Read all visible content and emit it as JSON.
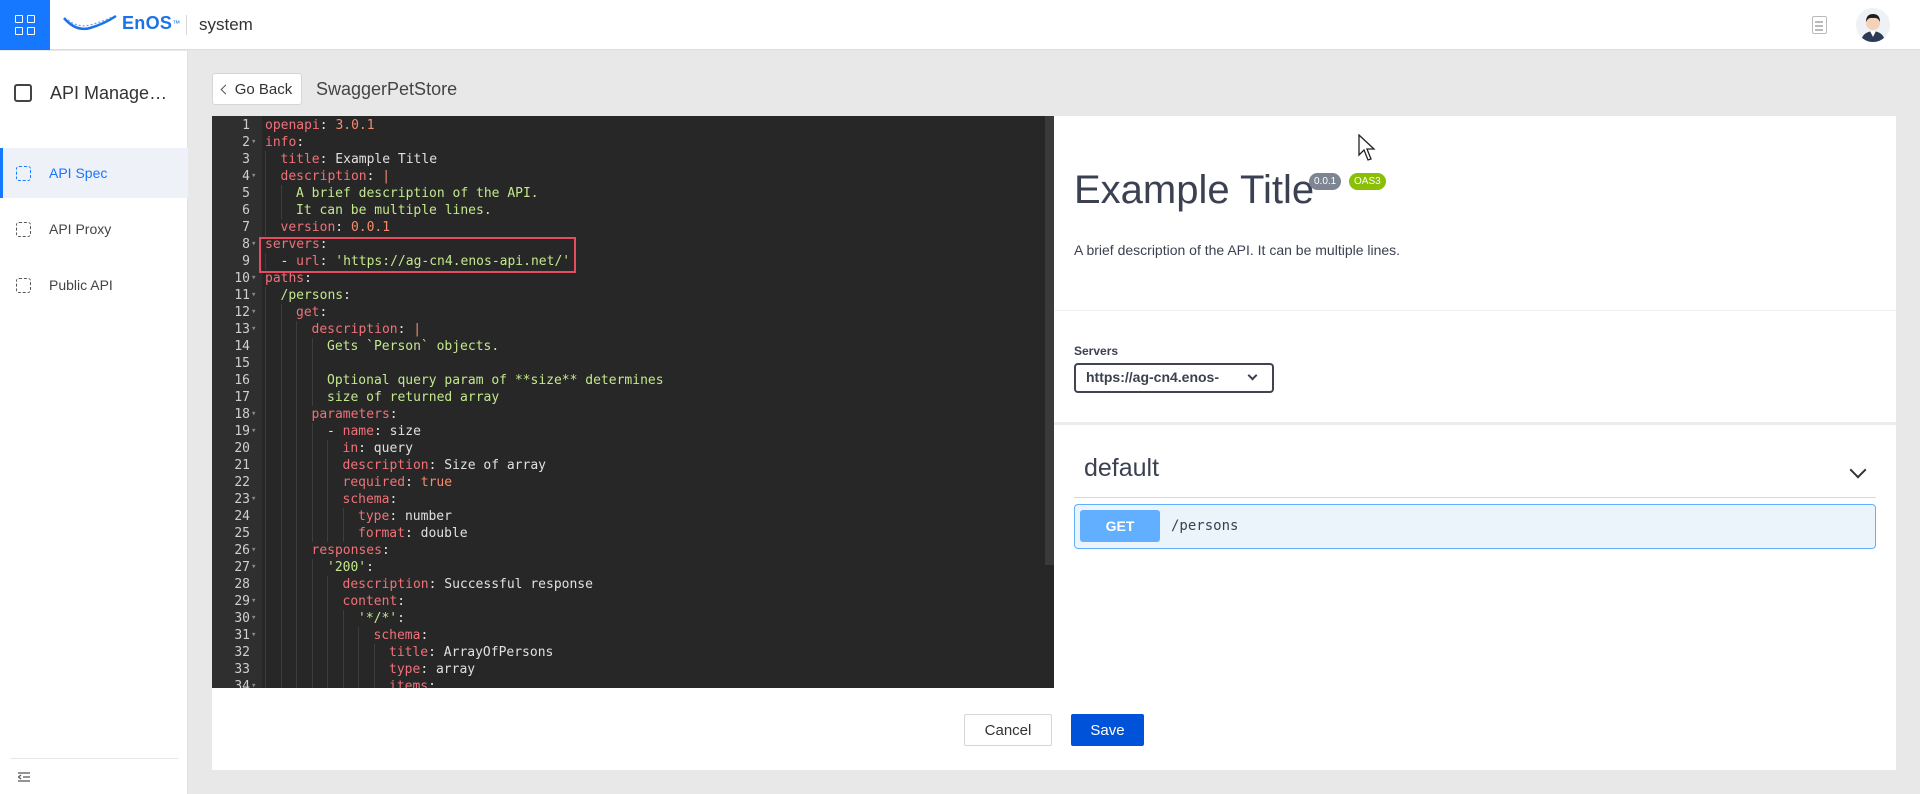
{
  "topbar": {
    "brand": "EnOS",
    "brand_tm": "™",
    "app_name": "system"
  },
  "sidebar": {
    "header": "API Management",
    "items": [
      {
        "label": "API Spec",
        "active": true
      },
      {
        "label": "API Proxy",
        "active": false
      },
      {
        "label": "Public API",
        "active": false
      }
    ]
  },
  "page": {
    "back_label": "Go Back",
    "title": "SwaggerPetStore"
  },
  "editor": {
    "lines": [
      {
        "n": "1",
        "fold": "",
        "indent": 0,
        "t": [
          [
            "k",
            "openapi"
          ],
          [
            "v",
            ": "
          ],
          [
            "n",
            "3.0.1"
          ]
        ]
      },
      {
        "n": "2",
        "fold": "▾",
        "indent": 0,
        "t": [
          [
            "k",
            "info"
          ],
          [
            "v",
            ":"
          ]
        ]
      },
      {
        "n": "3",
        "fold": "",
        "indent": 1,
        "t": [
          [
            "k",
            "title"
          ],
          [
            "v",
            ": Example Title"
          ]
        ]
      },
      {
        "n": "4",
        "fold": "▾",
        "indent": 1,
        "t": [
          [
            "k",
            "description"
          ],
          [
            "v",
            ": "
          ],
          [
            "n",
            "|"
          ]
        ]
      },
      {
        "n": "5",
        "fold": "",
        "indent": 2,
        "t": [
          [
            "s",
            "A brief description of the API."
          ]
        ]
      },
      {
        "n": "6",
        "fold": "",
        "indent": 2,
        "t": [
          [
            "s",
            "It can be multiple lines."
          ]
        ]
      },
      {
        "n": "7",
        "fold": "",
        "indent": 1,
        "t": [
          [
            "k",
            "version"
          ],
          [
            "v",
            ": "
          ],
          [
            "n",
            "0.0.1"
          ]
        ]
      },
      {
        "n": "8",
        "fold": "▾",
        "indent": 0,
        "t": [
          [
            "k",
            "servers"
          ],
          [
            "v",
            ":"
          ]
        ]
      },
      {
        "n": "9",
        "fold": "",
        "indent": 1,
        "t": [
          [
            "v",
            "- "
          ],
          [
            "k",
            "url"
          ],
          [
            "v",
            ": "
          ],
          [
            "s",
            "'https://ag-cn4.enos-api.net/'"
          ]
        ]
      },
      {
        "n": "10",
        "fold": "▾",
        "indent": 0,
        "t": [
          [
            "k",
            "paths"
          ],
          [
            "v",
            ":"
          ]
        ]
      },
      {
        "n": "11",
        "fold": "▾",
        "indent": 1,
        "t": [
          [
            "s",
            "/persons"
          ],
          [
            "v",
            ":"
          ]
        ]
      },
      {
        "n": "12",
        "fold": "▾",
        "indent": 2,
        "t": [
          [
            "k",
            "get"
          ],
          [
            "v",
            ":"
          ]
        ]
      },
      {
        "n": "13",
        "fold": "▾",
        "indent": 3,
        "t": [
          [
            "k",
            "description"
          ],
          [
            "v",
            ": "
          ],
          [
            "n",
            "|"
          ]
        ]
      },
      {
        "n": "14",
        "fold": "",
        "indent": 4,
        "t": [
          [
            "s",
            "Gets `Person` objects."
          ]
        ]
      },
      {
        "n": "15",
        "fold": "",
        "indent": 4,
        "t": [
          [
            "v",
            ""
          ]
        ]
      },
      {
        "n": "16",
        "fold": "",
        "indent": 4,
        "t": [
          [
            "s",
            "Optional query param of **size** determines"
          ]
        ]
      },
      {
        "n": "17",
        "fold": "",
        "indent": 4,
        "t": [
          [
            "s",
            "size of returned array"
          ]
        ]
      },
      {
        "n": "18",
        "fold": "▾",
        "indent": 3,
        "t": [
          [
            "k",
            "parameters"
          ],
          [
            "v",
            ":"
          ]
        ]
      },
      {
        "n": "19",
        "fold": "▾",
        "indent": 4,
        "t": [
          [
            "v",
            "- "
          ],
          [
            "k",
            "name"
          ],
          [
            "v",
            ": size"
          ]
        ]
      },
      {
        "n": "20",
        "fold": "",
        "indent": 5,
        "t": [
          [
            "k",
            "in"
          ],
          [
            "v",
            ": query"
          ]
        ]
      },
      {
        "n": "21",
        "fold": "",
        "indent": 5,
        "t": [
          [
            "k",
            "description"
          ],
          [
            "v",
            ": Size of array"
          ]
        ]
      },
      {
        "n": "22",
        "fold": "",
        "indent": 5,
        "t": [
          [
            "k",
            "required"
          ],
          [
            "v",
            ": "
          ],
          [
            "n",
            "true"
          ]
        ]
      },
      {
        "n": "23",
        "fold": "▾",
        "indent": 5,
        "t": [
          [
            "k",
            "schema"
          ],
          [
            "v",
            ":"
          ]
        ]
      },
      {
        "n": "24",
        "fold": "",
        "indent": 6,
        "t": [
          [
            "k",
            "type"
          ],
          [
            "v",
            ": number"
          ]
        ]
      },
      {
        "n": "25",
        "fold": "",
        "indent": 6,
        "t": [
          [
            "k",
            "format"
          ],
          [
            "v",
            ": double"
          ]
        ]
      },
      {
        "n": "26",
        "fold": "▾",
        "indent": 3,
        "t": [
          [
            "k",
            "responses"
          ],
          [
            "v",
            ":"
          ]
        ]
      },
      {
        "n": "27",
        "fold": "▾",
        "indent": 4,
        "t": [
          [
            "s",
            "'200'"
          ],
          [
            "v",
            ":"
          ]
        ]
      },
      {
        "n": "28",
        "fold": "",
        "indent": 5,
        "t": [
          [
            "k",
            "description"
          ],
          [
            "v",
            ": Successful response"
          ]
        ]
      },
      {
        "n": "29",
        "fold": "▾",
        "indent": 5,
        "t": [
          [
            "k",
            "content"
          ],
          [
            "v",
            ":"
          ]
        ]
      },
      {
        "n": "30",
        "fold": "▾",
        "indent": 6,
        "t": [
          [
            "s",
            "'*/*'"
          ],
          [
            "v",
            ":"
          ]
        ]
      },
      {
        "n": "31",
        "fold": "▾",
        "indent": 7,
        "t": [
          [
            "k",
            "schema"
          ],
          [
            "v",
            ":"
          ]
        ]
      },
      {
        "n": "32",
        "fold": "",
        "indent": 8,
        "t": [
          [
            "k",
            "title"
          ],
          [
            "v",
            ": ArrayOfPersons"
          ]
        ]
      },
      {
        "n": "33",
        "fold": "",
        "indent": 8,
        "t": [
          [
            "k",
            "type"
          ],
          [
            "v",
            ": array"
          ]
        ]
      },
      {
        "n": "34",
        "fold": "▾",
        "indent": 8,
        "t": [
          [
            "k",
            "items"
          ],
          [
            "v",
            ":"
          ]
        ]
      }
    ]
  },
  "preview": {
    "title": "Example Title",
    "version_badge": "0.0.1",
    "oas_badge": "OAS3",
    "description": "A brief description of the API. It can be multiple lines.",
    "servers_label": "Servers",
    "server_selected": "https://ag-cn4.enos-",
    "tag": "default",
    "operation": {
      "method": "GET",
      "path": "/persons"
    }
  },
  "footer": {
    "cancel_label": "Cancel",
    "save_label": "Save"
  },
  "colors": {
    "accent": "#1677ff",
    "save": "#0052d9",
    "get": "#61affe",
    "oas": "#89bf04",
    "highlight": "#e84a5f"
  }
}
